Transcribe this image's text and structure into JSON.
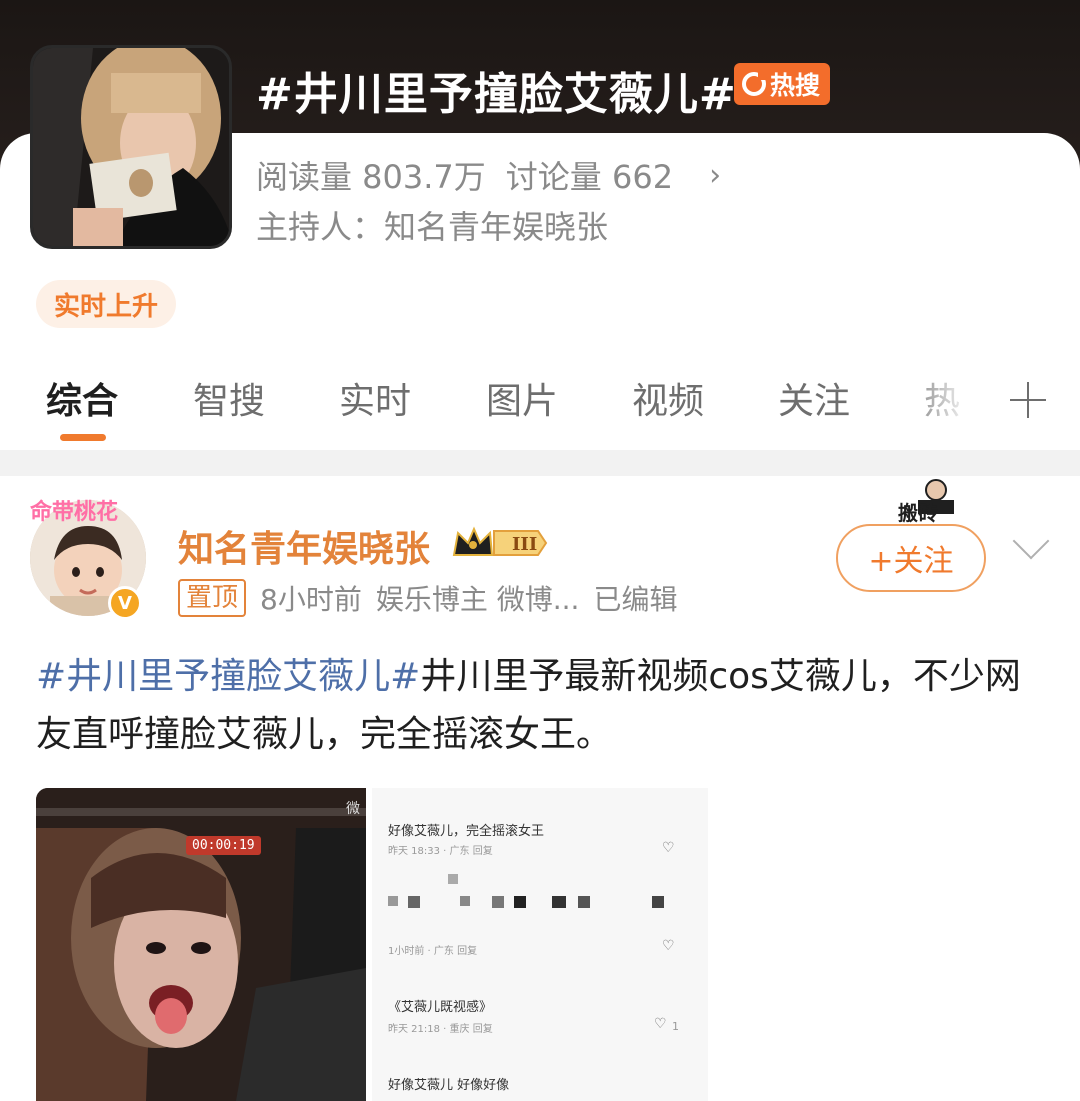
{
  "topic": {
    "title": "#井川里予撞脸艾薇儿#",
    "hot_badge": "热搜",
    "reads": "阅读量 803.7万",
    "discussions": "讨论量 662",
    "host": "主持人：知名青年娱晓张",
    "rising_label": "实时上升"
  },
  "tabs": [
    {
      "label": "综合",
      "active": true
    },
    {
      "label": "智搜"
    },
    {
      "label": "实时"
    },
    {
      "label": "图片"
    },
    {
      "label": "视频"
    },
    {
      "label": "关注"
    },
    {
      "label": "热"
    }
  ],
  "post": {
    "avatar_tag": "命带桃花",
    "author": "知名青年娱晓张",
    "level_badge": "III",
    "pinned": "置顶",
    "time": "8小时前",
    "source": "娱乐博主 微博...",
    "edited": "已编辑",
    "sticker_text": "搬砖",
    "follow_label": "+关注",
    "hashtag": "#井川里予撞脸艾薇儿#",
    "body": "井川里予最新视频cos艾薇儿，不少网友直呼撞脸艾薇儿，完全摇滚女王。"
  },
  "media": {
    "video_timer": "00:00:19",
    "watermark": "微",
    "comments": [
      {
        "text": "好像艾薇儿，完全摇滚女王",
        "meta": "昨天 18:33 · 广东    回复"
      },
      {
        "text": "",
        "meta": "1小时前 · 广东    回复"
      },
      {
        "text": "《艾薇儿既视感》",
        "meta": "昨天 21:18 · 重庆    回复",
        "likes": "1"
      },
      {
        "text": "好像艾薇儿 好像好像",
        "meta": ""
      }
    ]
  },
  "colors": {
    "accent": "#f07a2d",
    "hashtag": "#4e6fa8",
    "author": "#e3833a",
    "hot_badge": "#f36d2b"
  }
}
